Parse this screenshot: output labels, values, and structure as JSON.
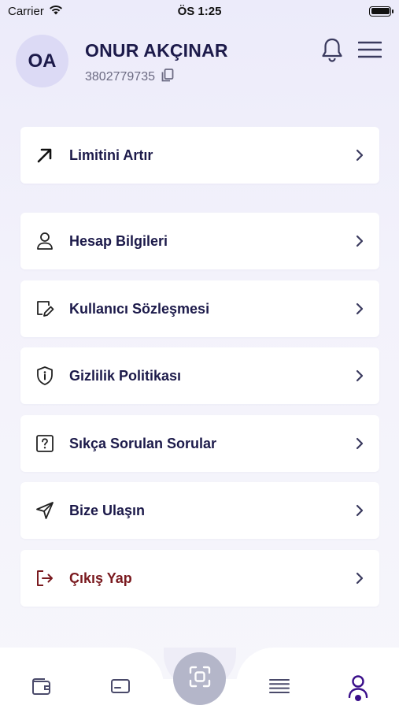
{
  "status_bar": {
    "carrier": "Carrier",
    "time": "ÖS 1:25"
  },
  "profile": {
    "initials": "OA",
    "name": "ONUR AKÇINAR",
    "id_number": "3802779735"
  },
  "menu": {
    "limit": "Limitini Artır",
    "account": "Hesap Bilgileri",
    "agreement": "Kullanıcı Sözleşmesi",
    "privacy": "Gizlilik Politikası",
    "faq": "Sıkça Sorulan Sorular",
    "contact": "Bize Ulaşın",
    "logout": "Çıkış Yap"
  },
  "colors": {
    "primary_text": "#1c1a4a",
    "danger_text": "#7a1a1f",
    "active_tab": "#3a0f8a",
    "scan_button": "#b4b6c9"
  },
  "tab_bar": {
    "tabs": [
      "wallet-icon",
      "card-icon",
      "scan-icon",
      "list-icon",
      "profile-icon"
    ],
    "active": "profile-icon"
  }
}
